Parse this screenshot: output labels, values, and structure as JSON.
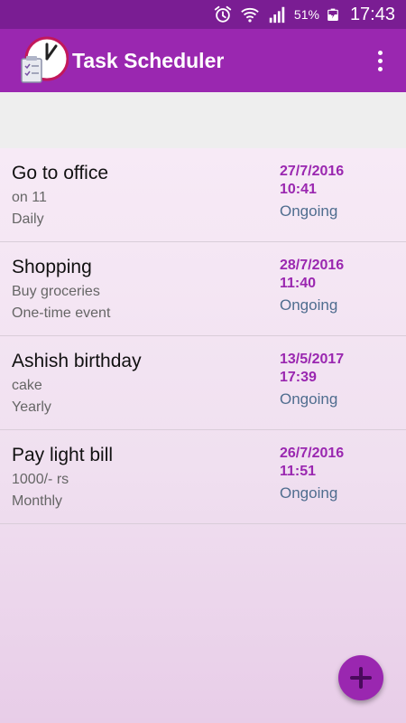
{
  "status_bar": {
    "battery_percent": "51%",
    "time": "17:43",
    "icons": [
      "alarm-icon",
      "wifi-icon",
      "signal-icon",
      "battery-charging-icon"
    ]
  },
  "app_bar": {
    "title": "Task Scheduler",
    "app_icon": "clock-checklist-icon",
    "menu_icon": "more-vert-icon"
  },
  "tasks": [
    {
      "title": "Go to office",
      "description": "on 11",
      "repeat": "Daily",
      "date": "27/7/2016",
      "time": "10:41",
      "status": "Ongoing"
    },
    {
      "title": "Shopping",
      "description": "Buy groceries",
      "repeat": "One-time event",
      "date": "28/7/2016",
      "time": "11:40",
      "status": "Ongoing"
    },
    {
      "title": "Ashish birthday",
      "description": "cake",
      "repeat": "Yearly",
      "date": "13/5/2017",
      "time": "17:39",
      "status": "Ongoing"
    },
    {
      "title": "Pay light bill",
      "description": "1000/- rs",
      "repeat": "Monthly",
      "date": "26/7/2016",
      "time": "11:51",
      "status": "Ongoing"
    }
  ],
  "fab": {
    "icon": "add-icon"
  },
  "colors": {
    "status_bar": "#7a1d93",
    "app_bar": "#9a27b0",
    "accent": "#9a27b0",
    "status_text": "#4f6d8f"
  }
}
